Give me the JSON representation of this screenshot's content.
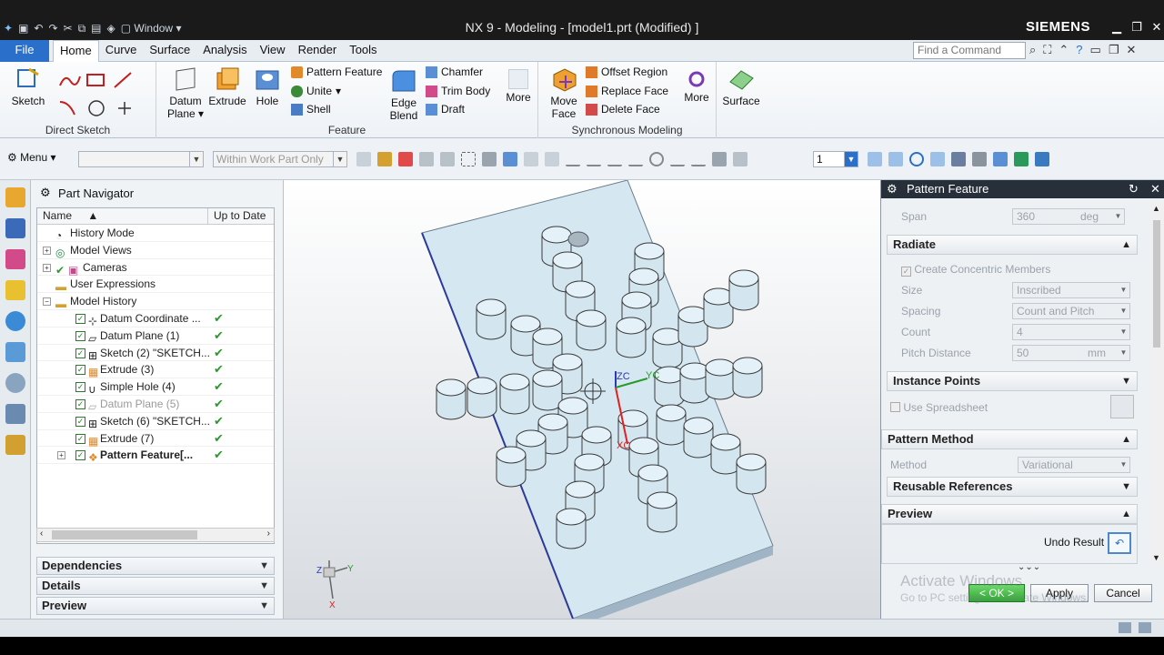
{
  "titlebar": {
    "window_menu": "Window",
    "title": "NX 9 - Modeling - [model1.prt (Modified) ]",
    "brand": "SIEMENS"
  },
  "menubar": {
    "file": "File",
    "tabs": [
      "Home",
      "Curve",
      "Surface",
      "Analysis",
      "View",
      "Render",
      "Tools"
    ],
    "find_placeholder": "Find a Command"
  },
  "ribbon": {
    "direct_sketch": {
      "sketch": "Sketch",
      "label": "Direct Sketch"
    },
    "feature": {
      "datum_plane": "Datum Plane",
      "extrude": "Extrude",
      "hole": "Hole",
      "pattern_feature": "Pattern Feature",
      "unite": "Unite",
      "shell": "Shell",
      "edge_blend": "Edge Blend",
      "chamfer": "Chamfer",
      "trim_body": "Trim Body",
      "draft": "Draft",
      "more": "More",
      "label": "Feature"
    },
    "sync": {
      "move_face": "Move Face",
      "offset_region": "Offset Region",
      "replace_face": "Replace Face",
      "delete_face": "Delete Face",
      "more": "More",
      "label": "Synchronous Modeling"
    },
    "surface": "Surface"
  },
  "toolbar2": {
    "menu": "Menu",
    "filter": "",
    "scope": "Within Work Part Only",
    "layer": "1"
  },
  "navigator": {
    "title": "Part Navigator",
    "col_name": "Name",
    "col_uptodate": "Up to Date",
    "rows": [
      {
        "label": "History Mode"
      },
      {
        "label": "Model Views"
      },
      {
        "label": "Cameras"
      },
      {
        "label": "User Expressions"
      },
      {
        "label": "Model History"
      },
      {
        "label": "Datum Coordinate ..."
      },
      {
        "label": "Datum Plane (1)"
      },
      {
        "label": "Sketch (2) \"SKETCH..."
      },
      {
        "label": "Extrude (3)"
      },
      {
        "label": "Simple Hole (4)"
      },
      {
        "label": "Datum Plane (5)"
      },
      {
        "label": "Sketch (6) \"SKETCH..."
      },
      {
        "label": "Extrude (7)"
      },
      {
        "label": "Pattern Feature[..."
      }
    ],
    "dependencies": "Dependencies",
    "details": "Details",
    "preview": "Preview"
  },
  "viewport": {
    "axis_zc": "ZC",
    "axis_yc": "YC",
    "axis_xc": "XC",
    "triad_z": "Z",
    "triad_y": "Y",
    "triad_x": "X"
  },
  "dialog": {
    "title": "Pattern Feature",
    "span_label": "Span",
    "span_value": "360",
    "span_unit": "deg",
    "radiate": "Radiate",
    "concentric": "Create Concentric Members",
    "size_label": "Size",
    "size_value": "Inscribed",
    "spacing_label": "Spacing",
    "spacing_value": "Count and Pitch",
    "count_label": "Count",
    "count_value": "4",
    "pitch_label": "Pitch Distance",
    "pitch_value": "50",
    "pitch_unit": "mm",
    "instance_points": "Instance Points",
    "use_spreadsheet": "Use Spreadsheet",
    "pattern_method": "Pattern Method",
    "method_label": "Method",
    "method_value": "Variational",
    "reusable_refs": "Reusable References",
    "preview": "Preview",
    "undo_result": "Undo Result",
    "ok": "< OK >",
    "apply": "Apply",
    "cancel": "Cancel"
  },
  "watermark": {
    "line1": "Activate Windows",
    "line2": "Go to PC settings to activate Windows."
  }
}
